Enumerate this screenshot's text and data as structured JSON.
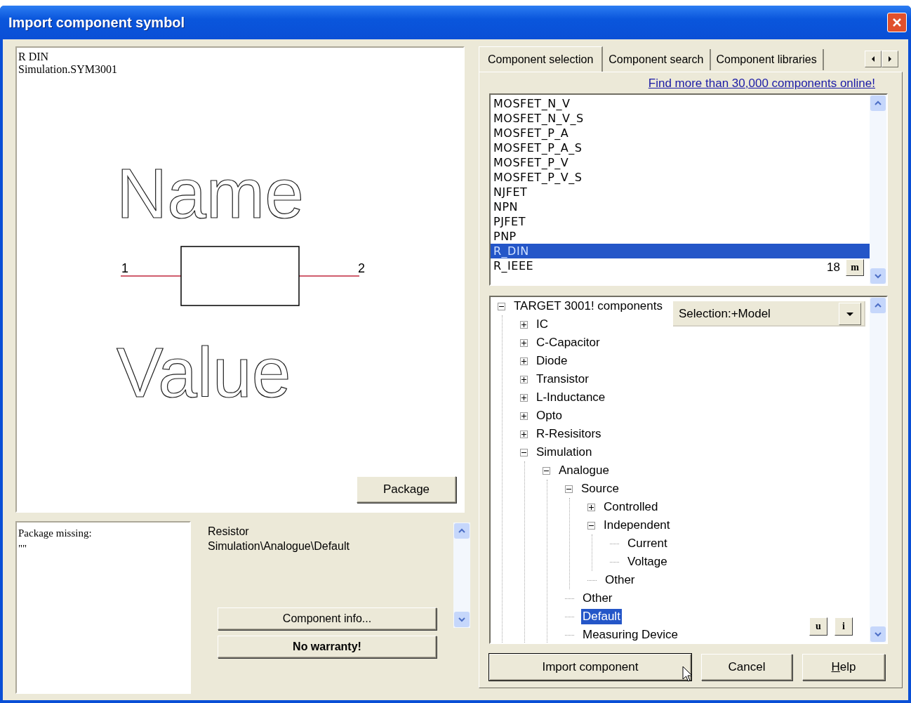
{
  "window": {
    "title": "Import component symbol"
  },
  "preview": {
    "name": "R DIN",
    "file": "Simulation.SYM3001",
    "name_label": "Name",
    "value_label": "Value",
    "pin_1": "1",
    "pin_2": "2",
    "package_button": "Package"
  },
  "package_status": {
    "lines": [
      "Package missing:",
      "\"\""
    ]
  },
  "info": {
    "lines": [
      "Resistor",
      "Simulation\\Analogue\\Default"
    ]
  },
  "info_buttons": [
    {
      "label": "Component info...",
      "bold": false
    },
    {
      "label": "No warranty!",
      "bold": true
    }
  ],
  "tabs": [
    {
      "label": "Component selection",
      "selected": true
    },
    {
      "label": "Component search",
      "selected": false
    },
    {
      "label": "Component libraries",
      "selected": false
    }
  ],
  "link": "Find more than 30,000 components online!",
  "component_list": {
    "items": [
      {
        "label": "MOSFET_N_V",
        "selected": false
      },
      {
        "label": "MOSFET_N_V_S",
        "selected": false
      },
      {
        "label": "MOSFET_P_A",
        "selected": false
      },
      {
        "label": "MOSFET_P_A_S",
        "selected": false
      },
      {
        "label": "MOSFET_P_V",
        "selected": false
      },
      {
        "label": "MOSFET_P_V_S",
        "selected": false
      },
      {
        "label": "NJFET",
        "selected": false
      },
      {
        "label": "NPN",
        "selected": false
      },
      {
        "label": "PJFET",
        "selected": false
      },
      {
        "label": "PNP",
        "selected": false
      },
      {
        "label": "R_DIN",
        "selected": true
      },
      {
        "label": "R_IEEE",
        "selected": false
      }
    ],
    "count": "18",
    "button": "m"
  },
  "tree": {
    "items": [
      {
        "label": "TARGET 3001! components",
        "expanded": true,
        "selected": false,
        "children": [
          {
            "label": "IC",
            "expanded": false,
            "selected": false
          },
          {
            "label": "C-Capacitor",
            "expanded": false,
            "selected": false
          },
          {
            "label": "Diode",
            "expanded": false,
            "selected": false
          },
          {
            "label": "Transistor",
            "expanded": false,
            "selected": false
          },
          {
            "label": "L-Inductance",
            "expanded": false,
            "selected": false
          },
          {
            "label": "Opto",
            "expanded": false,
            "selected": false
          },
          {
            "label": "R-Resisitors",
            "expanded": false,
            "selected": false
          },
          {
            "label": "Simulation",
            "expanded": true,
            "selected": false,
            "children": [
              {
                "label": "Analogue",
                "expanded": true,
                "selected": false,
                "children": [
                  {
                    "label": "Source",
                    "expanded": true,
                    "selected": false,
                    "children": [
                      {
                        "label": "Controlled",
                        "expanded": false,
                        "selected": false
                      },
                      {
                        "label": "Independent",
                        "expanded": true,
                        "selected": false,
                        "children": [
                          {
                            "label": "Current",
                            "selected": false
                          },
                          {
                            "label": "Voltage",
                            "selected": false
                          }
                        ]
                      },
                      {
                        "label": "Other",
                        "selected": false
                      }
                    ]
                  },
                  {
                    "label": "Other",
                    "selected": false
                  },
                  {
                    "label": "Default",
                    "selected": true
                  },
                  {
                    "label": "Measuring Device",
                    "selected": false
                  }
                ]
              }
            ]
          }
        ]
      }
    ],
    "dropdown": "Selection:+Model",
    "buttons": [
      "u",
      "i"
    ]
  },
  "buttons": [
    {
      "label": "Import component",
      "default": true,
      "first_letter_underlined": false
    },
    {
      "label": "Cancel",
      "default": false,
      "first_letter_underlined": false
    },
    {
      "label": "Help",
      "default": false,
      "first_letter_underlined": true
    }
  ]
}
